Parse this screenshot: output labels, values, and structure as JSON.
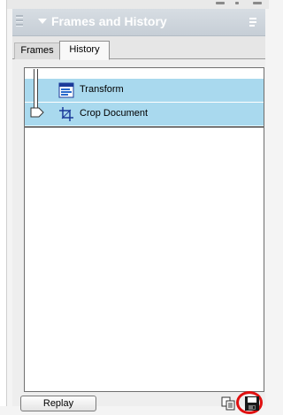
{
  "panel": {
    "title": "Frames and History"
  },
  "tabs": [
    {
      "label": "Frames"
    },
    {
      "label": "History"
    }
  ],
  "history": {
    "items": [
      {
        "label": "Transform",
        "icon": "transform-icon"
      },
      {
        "label": "Crop Document",
        "icon": "crop-icon"
      }
    ]
  },
  "footer": {
    "replay_label": "Replay"
  },
  "colors": {
    "selection": "#a9d9ee",
    "highlight_ring": "#e01010"
  }
}
